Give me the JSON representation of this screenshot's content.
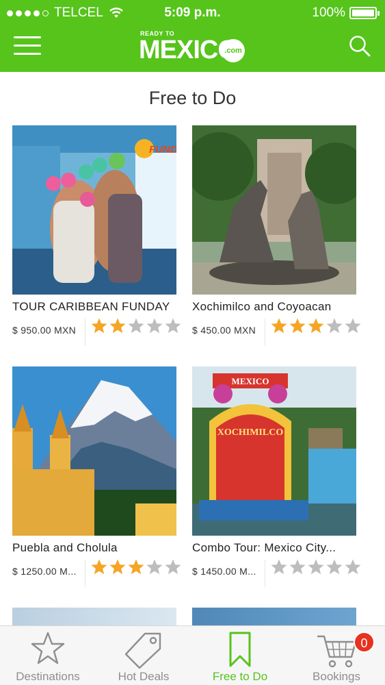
{
  "status_bar": {
    "carrier": "TELCEL",
    "time": "5:09 p.m.",
    "battery": "100%",
    "battery_level": 1.0
  },
  "nav": {
    "logo_small": "READY TO",
    "logo_main": "MEXICO",
    "logo_com": ".com",
    "menu_icon": "hamburger-icon",
    "search_icon": "search-icon"
  },
  "page": {
    "title": "Free to Do"
  },
  "tours": [
    {
      "name": "TOUR CARIBBEAN FUNDAY",
      "price": "$ 950.00 MXN",
      "rating": 2,
      "image_badge": "FUNDAY"
    },
    {
      "name": "Xochimilco and Coyoacan",
      "price": "$ 450.00 MXN",
      "rating": 3
    },
    {
      "name": "Puebla and Cholula",
      "price": "$ 1250.00 M...",
      "rating": 3
    },
    {
      "name": "Combo Tour: Mexico City...",
      "price": "$ 1450.00 M...",
      "rating": 0,
      "image_sign_1": "MEXICO",
      "image_sign_2": "XOCHIMILCO"
    }
  ],
  "tabs": [
    {
      "label": "Destinations",
      "icon": "star-outline-icon",
      "active": false
    },
    {
      "label": "Hot Deals",
      "icon": "tag-icon",
      "active": false
    },
    {
      "label": "Free to Do",
      "icon": "bookmark-icon",
      "active": true
    },
    {
      "label": "Bookings",
      "icon": "cart-icon",
      "active": false,
      "badge": "0"
    }
  ],
  "colors": {
    "brand_green": "#56c41b",
    "star_on": "#f5a524",
    "star_off": "#bdbdbd",
    "badge_red": "#e8321f"
  }
}
